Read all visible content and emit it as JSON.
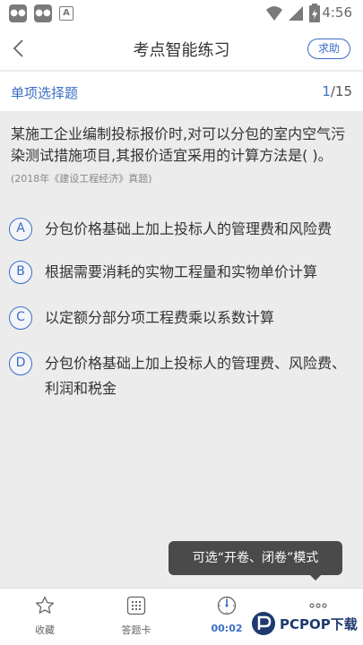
{
  "status_bar": {
    "time": "4:56",
    "notif_icons": [
      "app-icon",
      "app-icon",
      "a-icon"
    ]
  },
  "header": {
    "title": "考点智能练习",
    "help_label": "求助"
  },
  "question_bar": {
    "type": "单项选择题",
    "current": "1",
    "total": "/15"
  },
  "question": {
    "stem": "某施工企业编制投标报价时,对可以分包的室内空气污染测试措施项目,其报价适宜采用的计算方法是( )。",
    "source": "(2018年《建设工程经济》真题)"
  },
  "options": [
    {
      "letter": "A",
      "text": "分包价格基础上加上投标人的管理费和风险费"
    },
    {
      "letter": "B",
      "text": "根据需要消耗的实物工程量和实物单价计算"
    },
    {
      "letter": "C",
      "text": "以定额分部分项工程费乘以系数计算"
    },
    {
      "letter": "D",
      "text": "分包价格基础上加上投标人的管理费、风险费、利润和税金"
    }
  ],
  "tooltip": "可选“开卷、闭卷”模式",
  "bottom_tabs": [
    {
      "label": "收藏",
      "icon": "star-icon"
    },
    {
      "label": "答题卡",
      "icon": "grid-icon"
    },
    {
      "label": "00:02",
      "icon": "timer-icon"
    },
    {
      "label": "",
      "icon": "more-icon"
    }
  ],
  "watermark": {
    "text": "PCPOP下载"
  },
  "colors": {
    "accent": "#3a6ec4",
    "background": "#ececec",
    "text": "#333333"
  }
}
